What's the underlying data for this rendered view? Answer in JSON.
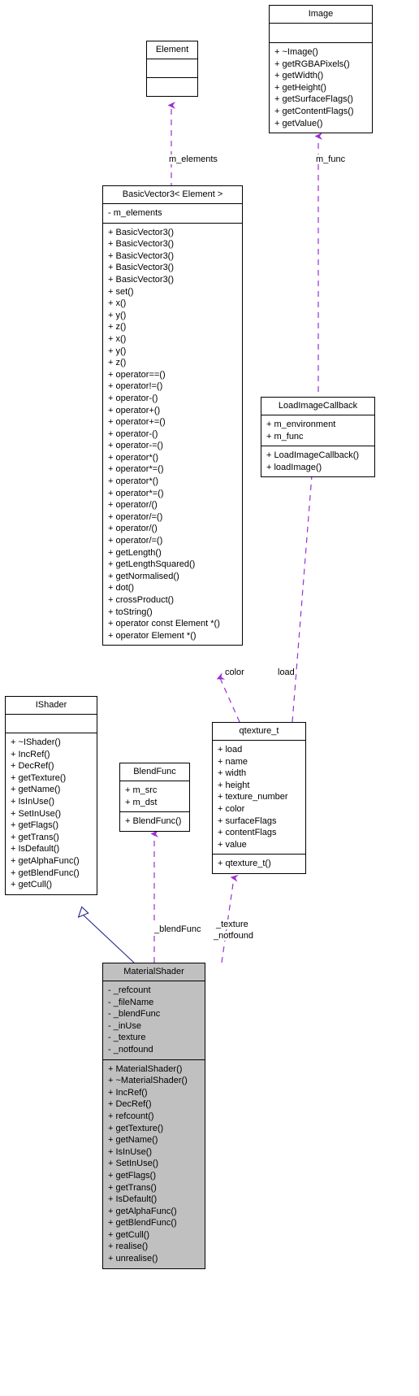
{
  "diagram": {
    "type": "uml-class-diagram",
    "colors": {
      "aggregation_edge": "#9b30d0",
      "inheritance_edge": "#26278a",
      "box_border": "#000000",
      "box_fill": "#ffffff",
      "highlight_fill": "#c0c0c0",
      "text": "#000000"
    },
    "classes": [
      {
        "id": "image",
        "name": "Image",
        "attributes": [],
        "methods": [
          "+ ~Image()",
          "+ getRGBAPixels()",
          "+ getWidth()",
          "+ getHeight()",
          "+ getSurfaceFlags()",
          "+ getContentFlags()",
          "+ getValue()"
        ]
      },
      {
        "id": "element",
        "name": "Element",
        "attributes": [],
        "methods": []
      },
      {
        "id": "basicvector3",
        "name": "BasicVector3< Element >",
        "attributes": [
          "- m_elements"
        ],
        "methods": [
          "+ BasicVector3()",
          "+ BasicVector3()",
          "+ BasicVector3()",
          "+ BasicVector3()",
          "+ BasicVector3()",
          "+ set()",
          "+ x()",
          "+ y()",
          "+ z()",
          "+ x()",
          "+ y()",
          "+ z()",
          "+ operator==()",
          "+ operator!=()",
          "+ operator-()",
          "+ operator+()",
          "+ operator+=()",
          "+ operator-()",
          "+ operator-=()",
          "+ operator*()",
          "+ operator*=()",
          "+ operator*()",
          "+ operator*=()",
          "+ operator/()",
          "+ operator/=()",
          "+ operator/()",
          "+ operator/=()",
          "+ getLength()",
          "+ getLengthSquared()",
          "+ getNormalised()",
          "+ dot()",
          "+ crossProduct()",
          "+ toString()",
          "+ operator const Element *()",
          "+ operator Element *()"
        ]
      },
      {
        "id": "loadimagecallback",
        "name": "LoadImageCallback",
        "attributes": [
          "+ m_environment",
          "+ m_func"
        ],
        "methods": [
          "+ LoadImageCallback()",
          "+ loadImage()"
        ]
      },
      {
        "id": "ishader",
        "name": "IShader",
        "attributes": [],
        "methods": [
          "+ ~IShader()",
          "+ IncRef()",
          "+ DecRef()",
          "+ getTexture()",
          "+ getName()",
          "+ IsInUse()",
          "+ SetInUse()",
          "+ getFlags()",
          "+ getTrans()",
          "+ IsDefault()",
          "+ getAlphaFunc()",
          "+ getBlendFunc()",
          "+ getCull()"
        ]
      },
      {
        "id": "blendfunc",
        "name": "BlendFunc",
        "attributes": [
          "+ m_src",
          "+ m_dst"
        ],
        "methods": [
          "+ BlendFunc()"
        ]
      },
      {
        "id": "qtexture",
        "name": "qtexture_t",
        "attributes": [
          "+ load",
          "+ name",
          "+ width",
          "+ height",
          "+ texture_number",
          "+ color",
          "+ surfaceFlags",
          "+ contentFlags",
          "+ value"
        ],
        "methods": [
          "+ qtexture_t()"
        ]
      },
      {
        "id": "materialshader",
        "name": "MaterialShader",
        "highlighted": true,
        "attributes": [
          "- _refcount",
          "- _fileName",
          "- _blendFunc",
          "- _inUse",
          "- _texture",
          "- _notfound"
        ],
        "methods": [
          "+ MaterialShader()",
          "+ ~MaterialShader()",
          "+ IncRef()",
          "+ DecRef()",
          "+ refcount()",
          "+ getTexture()",
          "+ getName()",
          "+ IsInUse()",
          "+ SetInUse()",
          "+ getFlags()",
          "+ getTrans()",
          "+ IsDefault()",
          "+ getAlphaFunc()",
          "+ getBlendFunc()",
          "+ getCull()",
          "+ realise()",
          "+ unrealise()"
        ]
      }
    ],
    "edge_labels": [
      {
        "id": "m_elements",
        "text": "m_elements"
      },
      {
        "id": "m_func",
        "text": "m_func"
      },
      {
        "id": "color",
        "text": "color"
      },
      {
        "id": "load",
        "text": "load"
      },
      {
        "id": "blendFunc",
        "text": "_blendFunc"
      },
      {
        "id": "texture",
        "text": "_texture"
      },
      {
        "id": "notfound",
        "text": "_notfound"
      }
    ]
  }
}
